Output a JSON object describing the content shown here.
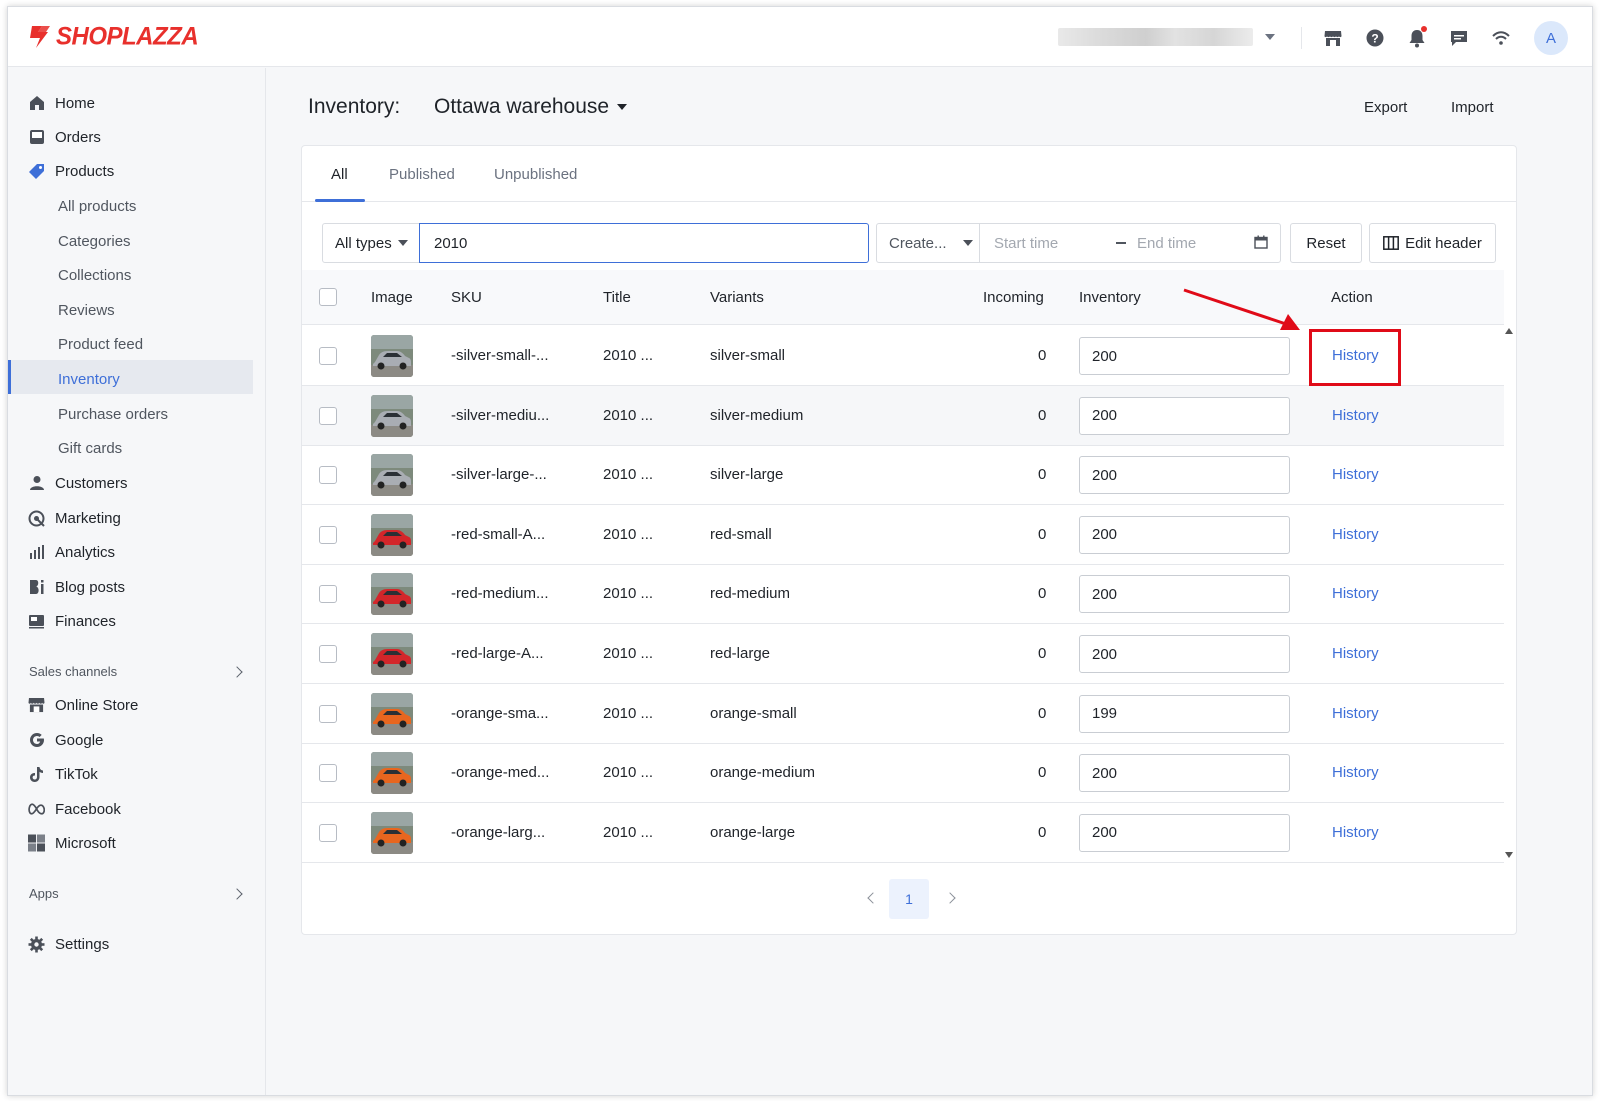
{
  "app": {
    "brand": "SHOPLAZZA",
    "avatar_initial": "A",
    "accent_color": "#3e6fd8",
    "brand_color": "#e8302c"
  },
  "topbar": {
    "icons": [
      "store-icon",
      "help-icon",
      "bell-icon",
      "chat-icon",
      "wifi-icon"
    ]
  },
  "sidebar": {
    "items": [
      {
        "label": "Home",
        "icon": "home-icon"
      },
      {
        "label": "Orders",
        "icon": "orders-icon"
      },
      {
        "label": "Products",
        "icon": "tag-icon"
      },
      {
        "label": "Customers",
        "icon": "person-icon"
      },
      {
        "label": "Marketing",
        "icon": "marketing-icon"
      },
      {
        "label": "Analytics",
        "icon": "bar-chart-icon"
      },
      {
        "label": "Blog posts",
        "icon": "blog-icon"
      },
      {
        "label": "Finances",
        "icon": "finance-icon"
      }
    ],
    "product_subitems": [
      "All products",
      "Categories",
      "Collections",
      "Reviews",
      "Product feed",
      "Inventory",
      "Purchase orders",
      "Gift cards"
    ],
    "sales_channels_label": "Sales channels",
    "channels": [
      {
        "label": "Online Store",
        "icon": "store-icon"
      },
      {
        "label": "Google",
        "icon": "google-icon"
      },
      {
        "label": "TikTok",
        "icon": "tiktok-icon"
      },
      {
        "label": "Facebook",
        "icon": "meta-icon"
      },
      {
        "label": "Microsoft",
        "icon": "microsoft-icon"
      }
    ],
    "apps_label": "Apps",
    "settings_label": "Settings"
  },
  "header": {
    "title": "Inventory:",
    "location": "Ottawa warehouse",
    "export_label": "Export",
    "import_label": "Import"
  },
  "tabs": [
    "All",
    "Published",
    "Unpublished"
  ],
  "filters": {
    "type_select": "All types",
    "search_value": "2010",
    "create_select": "Create...",
    "start_placeholder": "Start time",
    "end_placeholder": "End time",
    "reset_label": "Reset",
    "edit_header_label": "Edit header"
  },
  "table": {
    "columns": [
      "Image",
      "SKU",
      "Title",
      "Variants",
      "Incoming",
      "Inventory",
      "Action"
    ],
    "rows": [
      {
        "sku": "-silver-small-...",
        "title": "2010 ...",
        "variant": "silver-small",
        "incoming": "0",
        "inventory": "200",
        "action": "History",
        "color": "silver"
      },
      {
        "sku": "-silver-mediu...",
        "title": "2010 ...",
        "variant": "silver-medium",
        "incoming": "0",
        "inventory": "200",
        "action": "History",
        "color": "silver"
      },
      {
        "sku": "-silver-large-...",
        "title": "2010 ...",
        "variant": "silver-large",
        "incoming": "0",
        "inventory": "200",
        "action": "History",
        "color": "silver"
      },
      {
        "sku": "-red-small-A...",
        "title": "2010 ...",
        "variant": "red-small",
        "incoming": "0",
        "inventory": "200",
        "action": "History",
        "color": "red"
      },
      {
        "sku": "-red-medium...",
        "title": "2010 ...",
        "variant": "red-medium",
        "incoming": "0",
        "inventory": "200",
        "action": "History",
        "color": "red"
      },
      {
        "sku": "-red-large-A...",
        "title": "2010 ...",
        "variant": "red-large",
        "incoming": "0",
        "inventory": "200",
        "action": "History",
        "color": "red"
      },
      {
        "sku": "-orange-sma...",
        "title": "2010 ...",
        "variant": "orange-small",
        "incoming": "0",
        "inventory": "199",
        "action": "History",
        "color": "orange"
      },
      {
        "sku": "-orange-med...",
        "title": "2010 ...",
        "variant": "orange-medium",
        "incoming": "0",
        "inventory": "200",
        "action": "History",
        "color": "orange"
      },
      {
        "sku": "-orange-larg...",
        "title": "2010 ...",
        "variant": "orange-large",
        "incoming": "0",
        "inventory": "200",
        "action": "History",
        "color": "orange"
      }
    ]
  },
  "pagination": {
    "current_page": "1"
  },
  "car_colors": {
    "silver": "#a9adb3",
    "red": "#d3262a",
    "orange": "#e8661f"
  }
}
